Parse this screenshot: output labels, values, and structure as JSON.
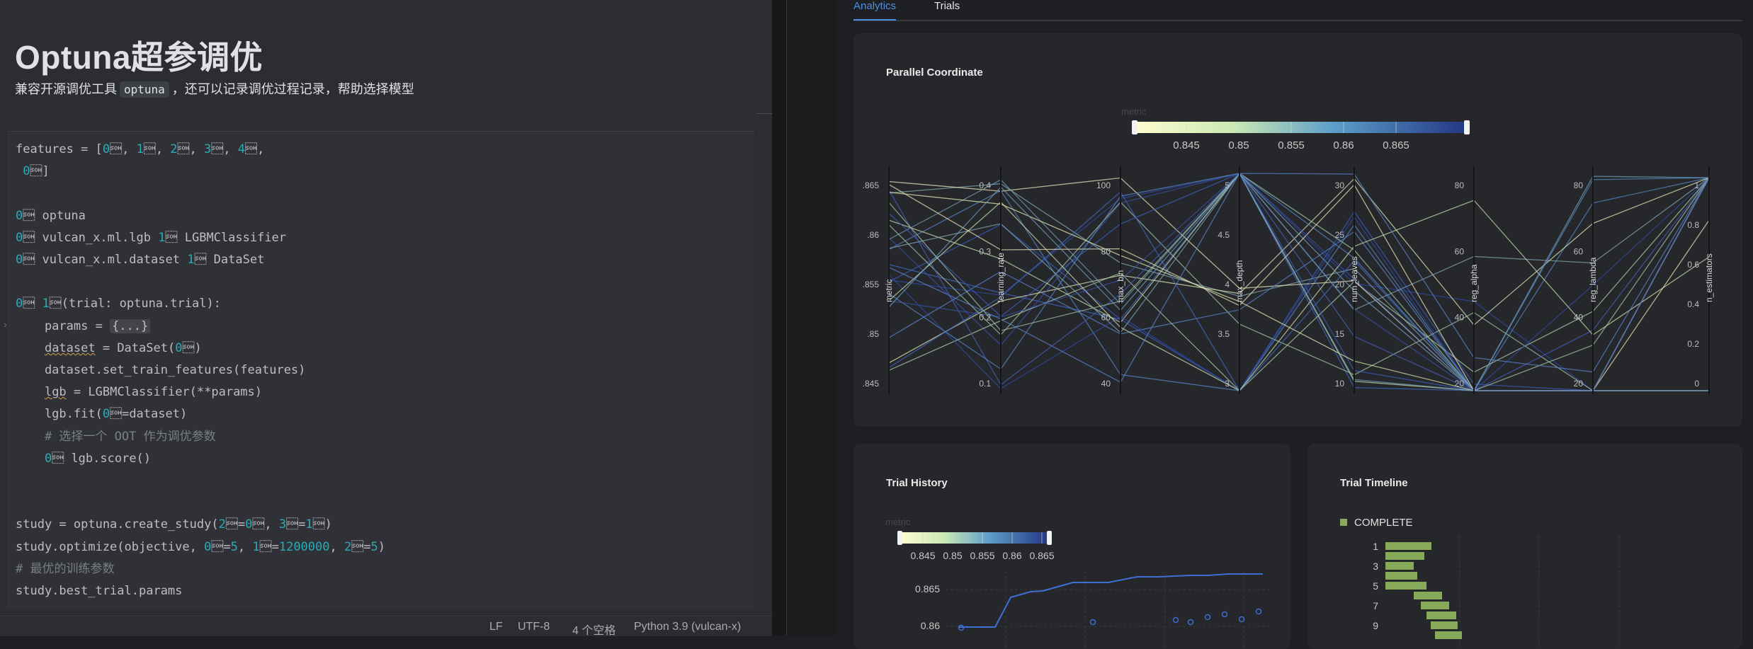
{
  "notebook": {
    "title": "Optuna超参调优",
    "subtitle_before": "兼容开源调优工具",
    "subtitle_code": "optuna",
    "subtitle_after": "，还可以记录调优过程记录，帮助选择模型"
  },
  "code_lines": [
    "features = [\"feature_1807\", \"feature_1816\", \"feature_1828\", \"feature_1830\", \"feature_1832\",",
    " \"feature_2425\"]",
    "",
    "import optuna",
    "from vulcan_x.ml.lgb import LGBMClassifier",
    "from vulcan_x.ml.dataset import DataSet",
    "",
    "def objective(trial: optuna.trial):",
    "    params = {...}",
    "    dataset = DataSet(\"dwtmp.mxflow_dataset_example\")",
    "    dataset.set_train_features(features)",
    "    lgb = LGBMClassifier(**params)",
    "    lgb.fit(X=dataset)",
    "    # 选择一个 OOT 作为调优参数",
    "    return lgb.score()",
    "",
    "",
    "study = optuna.create_study(study_name='my_study_demo', direction='maximize')",
    "study.optimize(objective, n_trials=5, timeout=1200000, n_jobs=5)",
    "# 最优的训练参数",
    "study.best_trial.params"
  ],
  "statusbar": {
    "line_ending": "LF",
    "encoding": "UTF-8",
    "indent": "4 个空格",
    "interpreter": "Python 3.9 (vulcan-x)"
  },
  "dashboard": {
    "tabs": [
      "Analytics",
      "Trials"
    ],
    "parallel_title": "Parallel Coordinate",
    "history_title": "Trial History",
    "timeline_title": "Trial Timeline",
    "colorbar_label": "metric",
    "colorbar_ticks": [
      "0.845",
      "0.85",
      "0.855",
      "0.86",
      "0.865"
    ],
    "timeline_legend": "COMPLETE",
    "axes": [
      "metric",
      "learning_rate",
      "max_bin",
      "max_depth",
      "num_leaves",
      "reg_alpha",
      "reg_lambda",
      "n_estimators"
    ],
    "axis_ticks": [
      [
        ".865",
        ".86",
        ".855",
        ".85",
        ".845"
      ],
      [
        "0.4",
        "0.3",
        "0.2",
        "0.1"
      ],
      [
        "100",
        "80",
        "60",
        "40"
      ],
      [
        "5",
        "4.5",
        "4",
        "3.5",
        "3"
      ],
      [
        "30",
        "25",
        "20",
        "15",
        "10"
      ],
      [
        "80",
        "60",
        "40",
        "20"
      ],
      [
        "80",
        "60",
        "40",
        "20"
      ],
      [
        "1",
        "0.8",
        "0.6",
        "0.4",
        "0.2",
        "0"
      ]
    ],
    "history_yticks": [
      "0.865",
      "0.86"
    ],
    "timeline_yticks": [
      "1",
      "3",
      "5",
      "7",
      "9"
    ]
  },
  "colors": {
    "accent": "#4a8fe0",
    "complete": "#86a95a"
  }
}
